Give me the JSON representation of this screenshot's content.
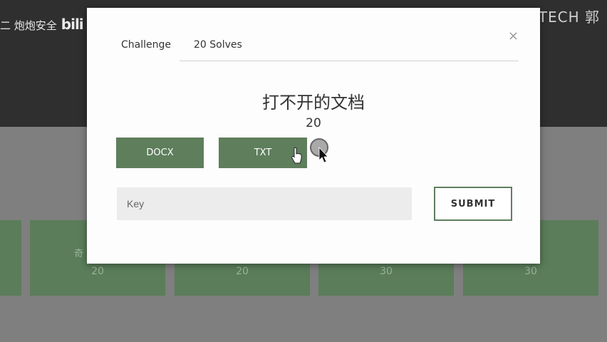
{
  "brand": {
    "channel": "二 炮炮安全",
    "logo_text": "bili"
  },
  "watermark": "GOKTECH 郭",
  "modal": {
    "tabs": [
      {
        "label": "Challenge"
      },
      {
        "label": "20 Solves"
      }
    ],
    "close_symbol": "×",
    "title": "打不开的文档",
    "value": "20",
    "files": [
      {
        "label": "DOCX"
      },
      {
        "label": "TXT"
      }
    ],
    "key_placeholder": "Key",
    "submit_label": "SUBMIT"
  },
  "background_cards": [
    {
      "name": "",
      "points": ""
    },
    {
      "name": "奇",
      "points": "20"
    },
    {
      "name": "",
      "points": "20"
    },
    {
      "name": "",
      "points": "30"
    },
    {
      "name": "",
      "points": "30"
    }
  ],
  "colors": {
    "accent": "#5e7e5c",
    "topbar": "#2f2f2f",
    "overlay": "#7f7f7f"
  }
}
